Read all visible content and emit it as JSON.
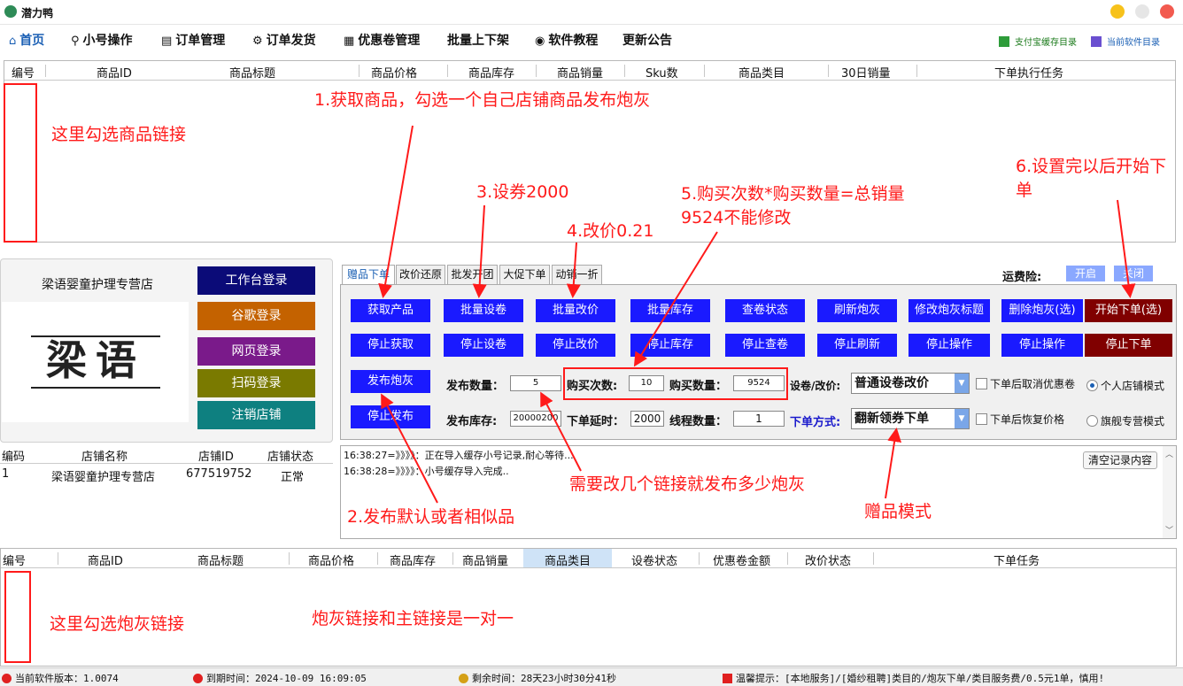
{
  "app": {
    "title": "潜力鸭"
  },
  "menu": {
    "items": [
      "首页",
      "小号操作",
      "订单管理",
      "订单发货",
      "优惠卷管理",
      "批量上下架",
      "软件教程",
      "更新公告"
    ],
    "right": [
      "支付宝缓存目录",
      "当前软件目录"
    ]
  },
  "product_grid": {
    "columns": [
      "编号",
      "商品ID",
      "商品标题",
      "商品价格",
      "商品库存",
      "商品销量",
      "Sku数",
      "商品类目",
      "30日销量",
      "下单执行任务"
    ]
  },
  "shop": {
    "name": "梁语婴童护理专营店",
    "logo_text": "梁语",
    "buttons": [
      "工作台登录",
      "谷歌登录",
      "网页登录",
      "扫码登录",
      "注销店铺"
    ],
    "columns": [
      "编码",
      "店铺名称",
      "店铺ID",
      "店铺状态"
    ],
    "rows": [
      {
        "code": "1",
        "name": "梁语婴童护理专营店",
        "id": "677519752",
        "status": "正常"
      }
    ]
  },
  "tabs": [
    "赠品下单",
    "改价还原",
    "批发开团",
    "大促下单",
    "动销一折"
  ],
  "freight": {
    "label": "运费险:",
    "on": "开启",
    "off": "关闭"
  },
  "ops": {
    "row1": [
      "获取产品",
      "批量设卷",
      "批量改价",
      "批量库存",
      "查卷状态",
      "刷新炮灰",
      "修改炮灰标题",
      "删除炮灰(选)",
      "开始下单(选)"
    ],
    "row2": [
      "停止获取",
      "停止设卷",
      "停止改价",
      "停止库存",
      "停止查卷",
      "停止刷新",
      "停止操作",
      "停止操作",
      "停止下单"
    ],
    "publish": "发布炮灰",
    "stop_publish": "停止发布"
  },
  "form": {
    "publish_qty_label": "发布数量：",
    "publish_qty": "5",
    "buy_times_label": "购买次数:",
    "buy_times": "10",
    "buy_qty_label": "购买数量：",
    "buy_qty": "9524",
    "coupon_label": "设卷/改价:",
    "coupon_mode": "普通设卷改价",
    "stock_label": "发布库存:",
    "stock": "20000200",
    "delay_label": "下单延时：",
    "delay": "2000",
    "threads_label": "线程数量：",
    "threads": "1",
    "order_mode_label": "下单方式:",
    "order_mode": "翻新领券下单",
    "chk1": "下单后取消优惠卷",
    "chk2": "下单后恢复价格",
    "radio1": "个人店铺模式",
    "radio2": "旗舰专营模式"
  },
  "log": {
    "lines": [
      "16:38:27=》》》》：正在导入缓存小号记录,耐心等待...",
      "16:38:28=》》》》：小号缓存导入完成.."
    ],
    "clear": "清空记录内容"
  },
  "bait_grid": {
    "columns": [
      "编号",
      "商品ID",
      "商品标题",
      "商品价格",
      "商品库存",
      "商品销量",
      "商品类目",
      "设卷状态",
      "优惠卷金额",
      "改价状态",
      "下单任务"
    ]
  },
  "annotations": {
    "a1": "1.获取商品，勾选一个自己店铺商品发布炮灰",
    "a_select_main": "这里勾选商品链接",
    "a3": "3.设券2000",
    "a4": "4.改价0.21",
    "a5": [
      "5.购买次数*购买数量=总销量",
      "9524不能修改"
    ],
    "a6": [
      "6.设置完以后开始下",
      "单"
    ],
    "a_bait_count": "需要改几个链接就发布多少炮灰",
    "a2": "2.发布默认或者相似品",
    "a_gift": "赠品模式",
    "a_select_bait": "这里勾选炮灰链接",
    "a_one_to_one": "炮灰链接和主链接是一对一"
  },
  "status": {
    "version": "当前软件版本：1.0074",
    "expire": "到期时间：2024-10-09 16:09:05",
    "remaining": "剩余时间：28天23小时30分41秒",
    "tip": "温馨提示：[本地服务]/[婚纱租聘]类目的/炮灰下单/类目服务费/0.5元1单，慎用!"
  },
  "colors": {
    "blue_btn": "#1a1aff",
    "dark_red_btn": "#800000",
    "annotation": "#ff1a1a",
    "menu_home": "#1a5fb4"
  }
}
